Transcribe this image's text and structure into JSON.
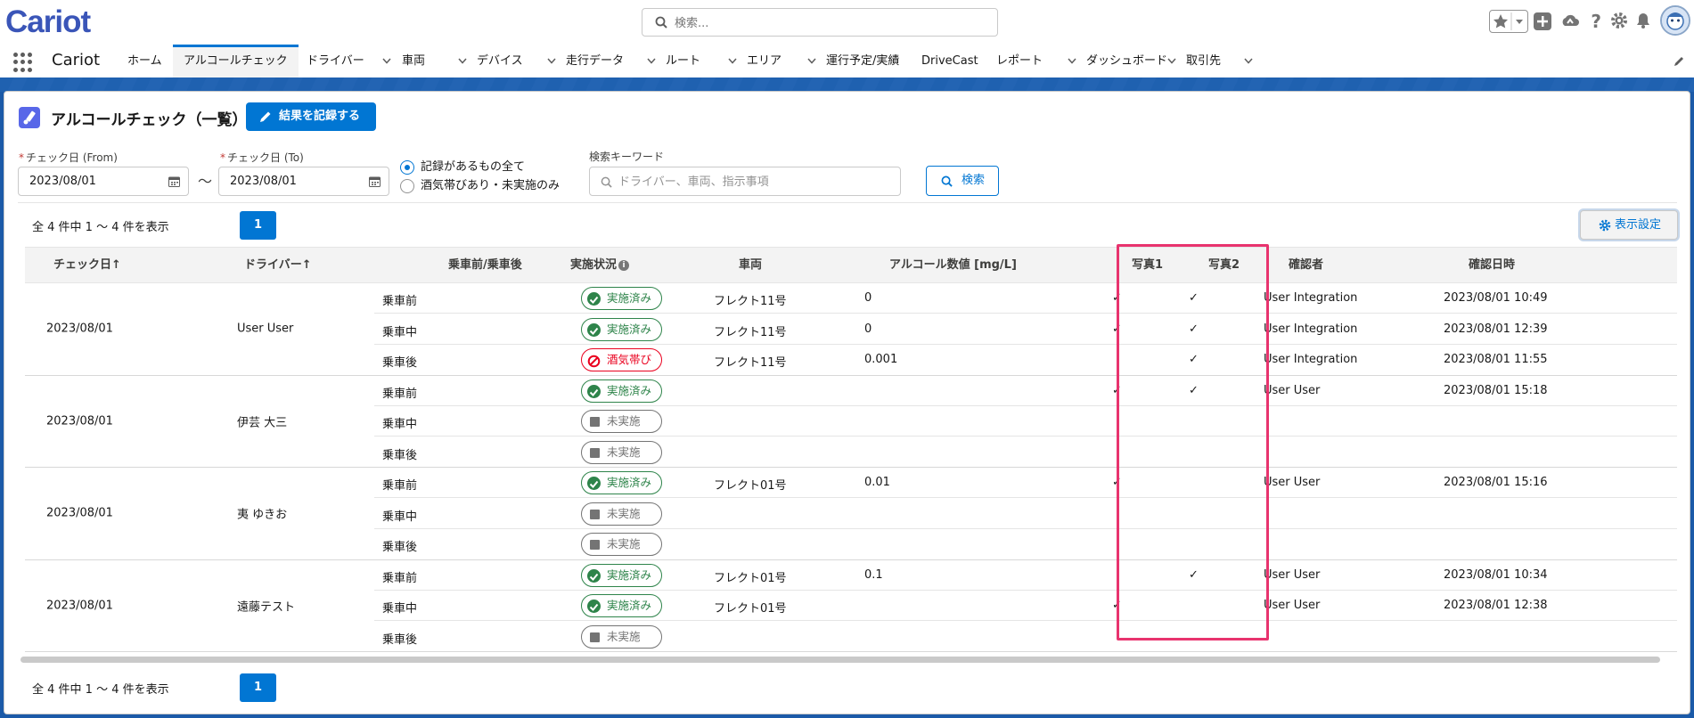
{
  "global": {
    "logo": "Cariot",
    "search_placeholder": "検索..."
  },
  "nav": {
    "app_name": "Cariot",
    "tabs": [
      {
        "label": "ホーム",
        "dropdown": false,
        "active": false
      },
      {
        "label": "アルコールチェック",
        "dropdown": false,
        "active": true
      },
      {
        "label": "ドライバー",
        "dropdown": true,
        "active": false
      },
      {
        "label": "車両",
        "dropdown": true,
        "active": false
      },
      {
        "label": "デバイス",
        "dropdown": true,
        "active": false
      },
      {
        "label": "走行データ",
        "dropdown": true,
        "active": false
      },
      {
        "label": "ルート",
        "dropdown": true,
        "active": false
      },
      {
        "label": "エリア",
        "dropdown": true,
        "active": false
      },
      {
        "label": "運行予定/実績",
        "dropdown": false,
        "active": false
      },
      {
        "label": "DriveCast",
        "dropdown": false,
        "active": false
      },
      {
        "label": "レポート",
        "dropdown": true,
        "active": false
      },
      {
        "label": "ダッシュボード",
        "dropdown": true,
        "active": false
      },
      {
        "label": "取引先",
        "dropdown": true,
        "active": false
      }
    ]
  },
  "page": {
    "title": "アルコールチェック（一覧）",
    "record_button": "結果を記録する"
  },
  "filters": {
    "date_from_label": "チェック日 (From)",
    "date_from_value": "2023/08/01",
    "date_to_label": "チェック日 (To)",
    "date_to_value": "2023/08/01",
    "required_mark": "*",
    "tilde": "〜",
    "radio_all": "記録があるもの全て",
    "radio_partial": "酒気帯びあり・未実施のみ",
    "keyword_label": "検索キーワード",
    "keyword_placeholder": "ドライバー、車両、指示事項",
    "search_button": "検索"
  },
  "pagination": {
    "count_label": "全 4 件中 1 〜 4 件を表示",
    "current_page": "1",
    "display_settings": "表示設定"
  },
  "table": {
    "headers": {
      "check_date": "チェック日↑",
      "driver": "ドライバー↑",
      "timing": "乗車前/乗車後",
      "status": "実施状況",
      "vehicle": "車両",
      "alcohol": "アルコール数値 [mg/L]",
      "photo1": "写真1",
      "photo2": "写真2",
      "confirmer": "確認者",
      "confirmed_at": "確認日時"
    },
    "groups": [
      {
        "date": "2023/08/01",
        "driver": "User User",
        "rows": [
          {
            "timing": "乗車前",
            "status": "実施済み",
            "status_type": "done",
            "vehicle": "フレクト11号",
            "alcohol": "0",
            "photo1": "✓",
            "photo2": "✓",
            "confirmer": "User Integration",
            "confirmed_at": "2023/08/01 10:49"
          },
          {
            "timing": "乗車中",
            "status": "実施済み",
            "status_type": "done",
            "vehicle": "フレクト11号",
            "alcohol": "0",
            "photo1": "✓",
            "photo2": "✓",
            "confirmer": "User Integration",
            "confirmed_at": "2023/08/01 12:39"
          },
          {
            "timing": "乗車後",
            "status": "酒気帯び",
            "status_type": "fail",
            "vehicle": "フレクト11号",
            "alcohol": "0.001",
            "photo1": "",
            "photo2": "✓",
            "confirmer": "User Integration",
            "confirmed_at": "2023/08/01 11:55"
          }
        ]
      },
      {
        "date": "2023/08/01",
        "driver": "伊芸 大三",
        "rows": [
          {
            "timing": "乗車前",
            "status": "実施済み",
            "status_type": "done",
            "vehicle": "",
            "alcohol": "",
            "photo1": "✓",
            "photo2": "✓",
            "confirmer": "User User",
            "confirmed_at": "2023/08/01 15:18"
          },
          {
            "timing": "乗車中",
            "status": "未実施",
            "status_type": "none",
            "vehicle": "",
            "alcohol": "",
            "photo1": "",
            "photo2": "",
            "confirmer": "",
            "confirmed_at": ""
          },
          {
            "timing": "乗車後",
            "status": "未実施",
            "status_type": "none",
            "vehicle": "",
            "alcohol": "",
            "photo1": "",
            "photo2": "",
            "confirmer": "",
            "confirmed_at": ""
          }
        ]
      },
      {
        "date": "2023/08/01",
        "driver": "夷 ゆきお",
        "rows": [
          {
            "timing": "乗車前",
            "status": "実施済み",
            "status_type": "done",
            "vehicle": "フレクト01号",
            "alcohol": "0.01",
            "photo1": "✓",
            "photo2": "",
            "confirmer": "User User",
            "confirmed_at": "2023/08/01 15:16"
          },
          {
            "timing": "乗車中",
            "status": "未実施",
            "status_type": "none",
            "vehicle": "",
            "alcohol": "",
            "photo1": "",
            "photo2": "",
            "confirmer": "",
            "confirmed_at": ""
          },
          {
            "timing": "乗車後",
            "status": "未実施",
            "status_type": "none",
            "vehicle": "",
            "alcohol": "",
            "photo1": "",
            "photo2": "",
            "confirmer": "",
            "confirmed_at": ""
          }
        ]
      },
      {
        "date": "2023/08/01",
        "driver": "遠藤テスト",
        "rows": [
          {
            "timing": "乗車前",
            "status": "実施済み",
            "status_type": "done",
            "vehicle": "フレクト01号",
            "alcohol": "0.1",
            "photo1": "",
            "photo2": "✓",
            "confirmer": "User User",
            "confirmed_at": "2023/08/01 10:34"
          },
          {
            "timing": "乗車中",
            "status": "実施済み",
            "status_type": "done",
            "vehicle": "フレクト01号",
            "alcohol": "",
            "photo1": "✓",
            "photo2": "",
            "confirmer": "User User",
            "confirmed_at": "2023/08/01 12:38"
          },
          {
            "timing": "乗車後",
            "status": "未実施",
            "status_type": "none",
            "vehicle": "",
            "alcohol": "",
            "photo1": "",
            "photo2": "",
            "confirmer": "",
            "confirmed_at": ""
          }
        ]
      }
    ]
  },
  "colors": {
    "brand_blue": "#0176d3",
    "done_green": "#2e844a",
    "fail_red": "#ea001e",
    "highlight_pink": "#e8336e"
  }
}
